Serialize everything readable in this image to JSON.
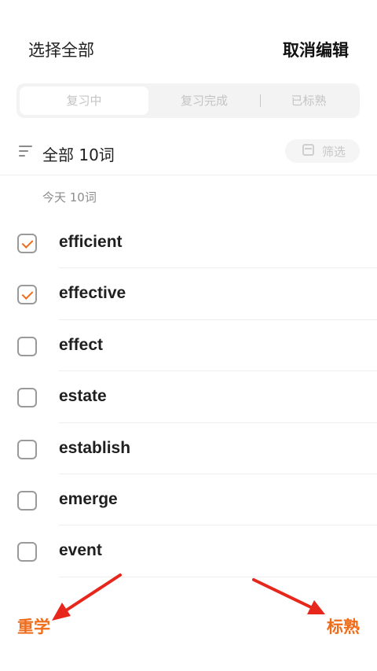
{
  "header": {
    "select_all": "选择全部",
    "cancel_edit": "取消编辑"
  },
  "tabs": [
    {
      "label": "复习中",
      "active": true
    },
    {
      "label": "复习完成",
      "active": false
    },
    {
      "label": "已标熟",
      "active": false
    }
  ],
  "filter": {
    "summary": "全部  10词",
    "button_label": "筛选",
    "icons": [
      "sort-lines-icon",
      "calendar-icon"
    ]
  },
  "group": {
    "title": "今天   10词"
  },
  "words": [
    {
      "word": "efficient",
      "checked": true
    },
    {
      "word": "effective",
      "checked": true
    },
    {
      "word": "effect",
      "checked": false
    },
    {
      "word": "estate",
      "checked": false
    },
    {
      "word": "establish",
      "checked": false
    },
    {
      "word": "emerge",
      "checked": false
    },
    {
      "word": "event",
      "checked": false
    }
  ],
  "footer": {
    "relearn": "重学",
    "mark_known": "标熟"
  },
  "colors": {
    "accent": "#ef6c1a",
    "annotation_arrow": "#e8271c"
  }
}
